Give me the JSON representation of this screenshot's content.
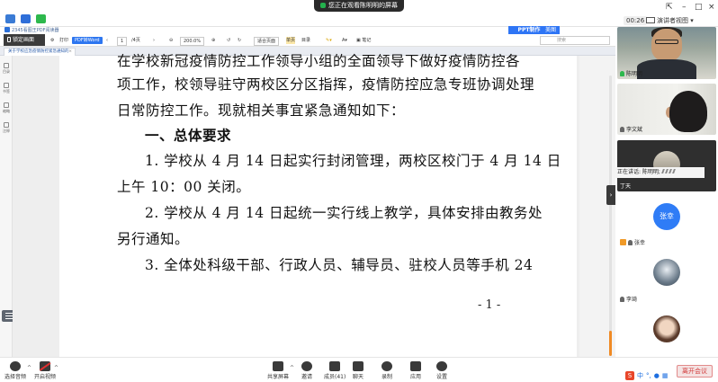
{
  "meeting": {
    "share_banner": "您正在观看陈明明的屏幕",
    "timer": "00:26",
    "view_mode": "演讲者视图"
  },
  "pdf_app": {
    "title": "2345看图王PDF阅读器",
    "lock_screen": "锁定画面",
    "toolbar": {
      "pdf_to": "PDF转Word",
      "page_current": "1",
      "page_total": "/4页",
      "zoom": "200.0%",
      "single_page": "适合页面",
      "mode_page": "单页",
      "mode_continuous": "目录",
      "note": "笔记"
    },
    "ppt_badge": "PPT制作",
    "ppt_badge2": "美图",
    "search_placeholder": "搜索",
    "tab_label": "关于学校应急疫情防控紧急通知的",
    "left_sidebar": [
      "目录",
      "书签",
      "缩略",
      "注释"
    ]
  },
  "document": {
    "lines": [
      "在学校新冠疫情防控工作领导小组的全面领导下做好疫情防控各",
      "项工作，校领导驻守两校区分区指挥，疫情防控应急专班协调处理",
      "日常防控工作。现就相关事宜紧急通知如下：",
      "一、总体要求",
      "1. 学校从 4 月 14 日起实行封闭管理，两校区校门于 4 月 14 日",
      "上午 10：00 关闭。",
      "2. 学校从 4 月 14 日起统一实行线上教学，具体安排由教务处",
      "另行通知。",
      "3. 全体处科级干部、行政人员、辅导员、驻校人员等手机 24"
    ],
    "page_number": "- 1 -"
  },
  "bottom_bar": {
    "mute": "选择音频",
    "video": "开启视频",
    "share": "共享屏幕",
    "invite": "邀请",
    "members": "成员(41)",
    "chat": "聊天",
    "record": "录制",
    "apps": "应用",
    "settings": "设置",
    "end": "离开会议"
  },
  "participants": {
    "p1": "陈明明",
    "p2": "李文斌",
    "speaking": "正在讲话: 陈明明;",
    "p3": "丁天",
    "p4_avatar": "张幸",
    "p4": "张幸",
    "p5": "李琦",
    "p6": ""
  }
}
